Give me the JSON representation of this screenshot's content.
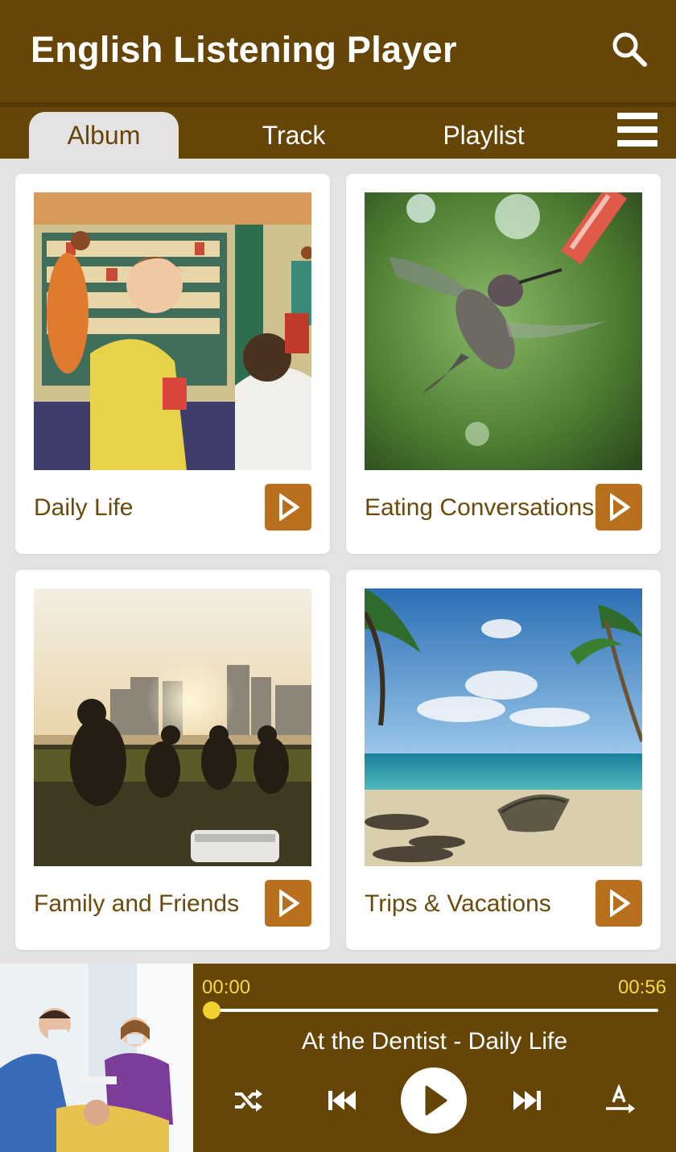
{
  "app": {
    "title": "English Listening Player"
  },
  "tabs": [
    {
      "label": "Album",
      "active": true
    },
    {
      "label": "Track",
      "active": false
    },
    {
      "label": "Playlist",
      "active": false
    }
  ],
  "albums": [
    {
      "title": "Daily Life",
      "art": "vintage-grocery-store"
    },
    {
      "title": "Eating Conversations",
      "art": "hummingbird"
    },
    {
      "title": "Family and Friends",
      "art": "park-picnic-city-sunset"
    },
    {
      "title": "Trips & Vacations",
      "art": "tropical-beach-boat"
    }
  ],
  "player": {
    "elapsed": "00:00",
    "duration": "00:56",
    "progress": 0.0,
    "now_playing": "At the Dentist - Daily Life",
    "art": "dentist-scene",
    "controls": [
      "shuffle-icon",
      "previous-icon",
      "play-icon",
      "next-icon",
      "translate-icon"
    ]
  },
  "colors": {
    "primary": "#654607",
    "accent": "#b8701f",
    "highlight": "#f6d74a",
    "background": "#e4e2e2"
  }
}
